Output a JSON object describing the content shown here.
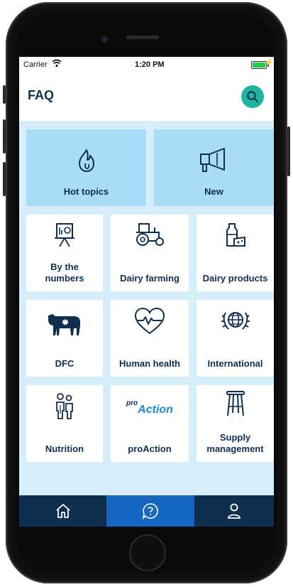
{
  "status": {
    "carrier": "Carrier",
    "time": "1:20 PM",
    "wifi_icon": "wifi-icon",
    "battery_level": 1.0
  },
  "header": {
    "title": "FAQ",
    "search_icon": "search-icon"
  },
  "tiles": {
    "hot_topics": {
      "label": "Hot topics",
      "icon": "flame-icon"
    },
    "new": {
      "label": "New",
      "icon": "megaphone-icon"
    },
    "by_the_numbers": {
      "label": "By the numbers",
      "icon": "chart-board-icon"
    },
    "dairy_farming": {
      "label": "Dairy farming",
      "icon": "tractor-icon"
    },
    "dairy_products": {
      "label": "Dairy products",
      "icon": "milk-cheese-icon"
    },
    "dfc": {
      "label": "DFC",
      "icon": "cow-icon"
    },
    "human_health": {
      "label": "Human health",
      "icon": "heart-pulse-icon"
    },
    "international": {
      "label": "International",
      "icon": "globe-laurel-icon"
    },
    "nutrition": {
      "label": "Nutrition",
      "icon": "family-icon"
    },
    "proaction": {
      "label": "proAction",
      "logo_prefix": "pro",
      "logo_text": "Action",
      "icon": "proaction-logo"
    },
    "supply_management": {
      "label": "Supply management",
      "icon": "stool-icon"
    }
  },
  "tabbar": {
    "items": [
      {
        "name": "home",
        "icon": "home-icon"
      },
      {
        "name": "faq",
        "icon": "help-icon",
        "active": true
      },
      {
        "name": "profile",
        "icon": "user-icon"
      }
    ]
  },
  "colors": {
    "background": "#d6eefb",
    "large_tile": "#a8dcf7",
    "text": "#0f2f50",
    "accent": "#1fb3a2",
    "tabbar": "#0f2f50",
    "tab_active": "#1466c0"
  }
}
